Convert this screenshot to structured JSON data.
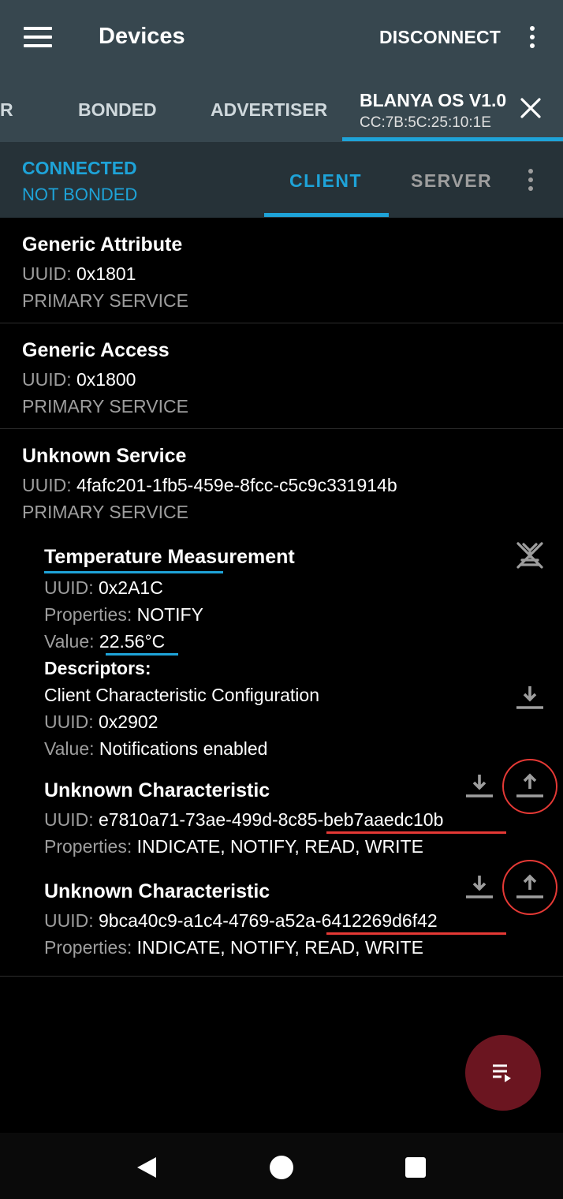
{
  "appbar": {
    "title": "Devices",
    "disconnect_label": "DISCONNECT",
    "menu_icon": "hamburger-menu-icon",
    "overflow_icon": "more-vertical-icon"
  },
  "tabs": {
    "partial_tab": "R",
    "bonded": "BONDED",
    "advertiser": "ADVERTISER",
    "active_name": "BLANYA OS V1.0",
    "active_mac": "CC:7B:5C:25:10:1E",
    "close_icon": "close-icon"
  },
  "status": {
    "connection": "CONNECTED",
    "bond": "NOT BONDED",
    "client_tab": "CLIENT",
    "server_tab": "SERVER"
  },
  "services": [
    {
      "name": "Generic Attribute",
      "uuid_label": "UUID: ",
      "uuid": "0x1801",
      "type": "PRIMARY SERVICE"
    },
    {
      "name": "Generic Access",
      "uuid_label": "UUID: ",
      "uuid": "0x1800",
      "type": "PRIMARY SERVICE"
    },
    {
      "name": "Unknown Service",
      "uuid_label": "UUID: ",
      "uuid": "4fafc201-1fb5-459e-8fcc-c5c9c331914b",
      "type": "PRIMARY SERVICE"
    }
  ],
  "characteristics": [
    {
      "name": "Temperature Measurement",
      "uuid_label": "UUID: ",
      "uuid": "0x2A1C",
      "props_label": "Properties: ",
      "props": "NOTIFY",
      "value_label": "Value: ",
      "value": "22.56°C",
      "descriptors_label": "Descriptors:",
      "descriptor": {
        "name": "Client Characteristic Configuration",
        "uuid_label": "UUID: ",
        "uuid": "0x2902",
        "value_label": "Value: ",
        "value": "Notifications enabled"
      }
    },
    {
      "name": "Unknown Characteristic",
      "uuid_label": "UUID: ",
      "uuid": "e7810a71-73ae-499d-8c85-beb7aaedc10b",
      "props_label": "Properties: ",
      "props": "INDICATE, NOTIFY, READ, WRITE"
    },
    {
      "name": "Unknown Characteristic",
      "uuid_label": "UUID: ",
      "uuid": "9bca40c9-a1c4-4769-a52a-6412269d6f42",
      "props_label": "Properties: ",
      "props": "INDICATE, NOTIFY, READ, WRITE"
    }
  ],
  "colors": {
    "appbar": "#37474f",
    "statusbar": "#263238",
    "accent": "#1ea3d8",
    "annotation_red": "#e53935",
    "fab": "#6b1520"
  }
}
